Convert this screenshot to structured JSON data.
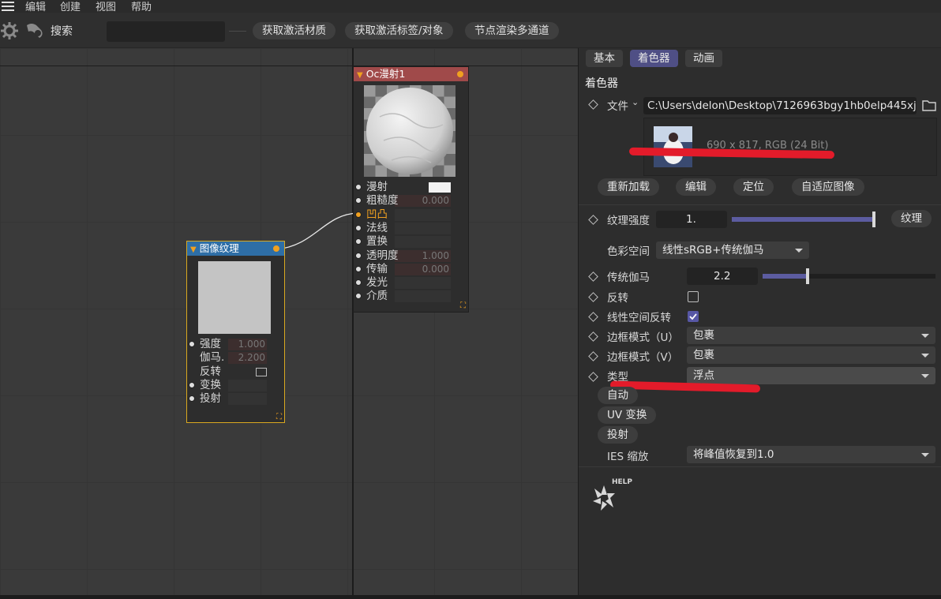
{
  "menu": {
    "items": [
      "编辑",
      "创建",
      "视图",
      "帮助"
    ]
  },
  "toolbar": {
    "search_label": "搜索",
    "search_value": "",
    "buttons": [
      "获取激活材质",
      "获取激活标签/对象",
      "节点渲染多通道"
    ]
  },
  "nodes": {
    "diffuse": {
      "title": "Oc漫射1",
      "ports": [
        {
          "label": "漫射",
          "value": ""
        },
        {
          "label": "粗糙度",
          "value": "0.000"
        },
        {
          "label": "凹凸",
          "value": ""
        },
        {
          "label": "法线",
          "value": ""
        },
        {
          "label": "置换",
          "value": ""
        },
        {
          "label": "透明度",
          "value": "1.000"
        },
        {
          "label": "传输",
          "value": "0.000"
        },
        {
          "label": "发光",
          "value": ""
        },
        {
          "label": "介质",
          "value": ""
        }
      ]
    },
    "image_texture": {
      "title": "图像纹理",
      "ports": [
        {
          "label": "强度",
          "value": "1.000"
        },
        {
          "label": "伽马.",
          "value": "2.200"
        },
        {
          "label": "反转",
          "value": ""
        },
        {
          "label": "变换",
          "value": ""
        },
        {
          "label": "投射",
          "value": ""
        }
      ]
    }
  },
  "panel": {
    "tabs": [
      "基本",
      "着色器",
      "动画"
    ],
    "active_tab": "着色器",
    "section_title": "着色器",
    "file_label": "文件",
    "file_path": "C:\\Users\\delon\\Desktop\\7126963bgy1hb0elp445xj",
    "image_info": "690 x 817, RGB (24 Bit)",
    "file_buttons": [
      "重新加载",
      "编辑",
      "定位",
      "自适应图像"
    ],
    "texture_strength_label": "纹理强度",
    "texture_strength_value": "1.",
    "texture_button": "纹理",
    "color_space_label": "色彩空间",
    "color_space_value": "线性sRGB+传统伽马",
    "gamma_label": "传统伽马",
    "gamma_value": "2.2",
    "invert_label": "反转",
    "invert_checked": false,
    "linear_invert_label": "线性空间反转",
    "linear_invert_checked": true,
    "border_u_label": "边框模式（U）",
    "border_u_value": "包裹",
    "border_v_label": "边框模式（V）",
    "border_v_value": "包裹",
    "type_label": "类型",
    "type_value": "浮点",
    "extra_buttons": [
      "自动",
      "UV 变换",
      "投射"
    ],
    "ies_label": "IES 缩放",
    "ies_value": "将峰值恢复到1.0",
    "help_label": "HELP"
  },
  "colors": {
    "accent": "#4f4f85",
    "node_diffuse": "#a04a4a",
    "node_texture": "#2e6ea6",
    "annotation": "#e31b2a"
  }
}
